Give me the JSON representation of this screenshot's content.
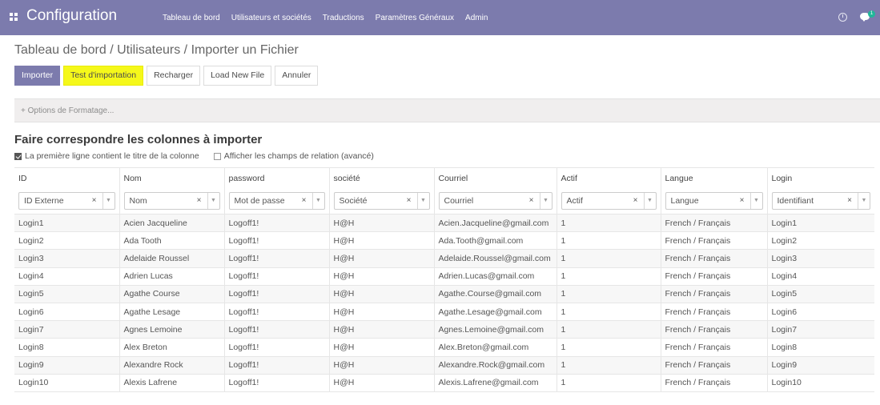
{
  "topbar": {
    "app_title": "Configuration",
    "menu": [
      "Tableau de bord",
      "Utilisateurs et sociétés",
      "Traductions",
      "Paramètres Généraux",
      "Admin"
    ],
    "chat_badge": "1",
    "bar_color": "#7c7bad"
  },
  "breadcrumb": "Tableau de bord / Utilisateurs / Importer un Fichier",
  "buttons": {
    "import": "Importer",
    "test_import": "Test d'importation",
    "reload": "Recharger",
    "load_new_file": "Load New File",
    "cancel": "Annuler"
  },
  "options_label": "+ Options de Formatage...",
  "section_title": "Faire correspondre les colonnes à importer",
  "checkboxes": {
    "first_line_header": {
      "label": "La première ligne contient le titre de la colonne",
      "checked": true
    },
    "show_relation_fields": {
      "label": "Afficher les champs de relation (avancé)",
      "checked": false
    }
  },
  "table": {
    "headers": [
      "ID",
      "Nom",
      "password",
      "société",
      "Courriel",
      "Actif",
      "Langue",
      "Login"
    ],
    "mappings": [
      "ID Externe",
      "Nom",
      "Mot de passe",
      "Société",
      "Courriel",
      "Actif",
      "Langue",
      "Identifiant"
    ],
    "rows": [
      [
        "Login1",
        "Acien Jacqueline",
        "Logoff1!",
        "H@H",
        "Acien.Jacqueline@gmail.com",
        "1",
        "French / Français",
        "Login1"
      ],
      [
        "Login2",
        "Ada Tooth",
        "Logoff1!",
        "H@H",
        "Ada.Tooth@gmail.com",
        "1",
        "French / Français",
        "Login2"
      ],
      [
        "Login3",
        "Adelaide Roussel",
        "Logoff1!",
        "H@H",
        "Adelaide.Roussel@gmail.com",
        "1",
        "French / Français",
        "Login3"
      ],
      [
        "Login4",
        "Adrien Lucas",
        "Logoff1!",
        "H@H",
        "Adrien.Lucas@gmail.com",
        "1",
        "French / Français",
        "Login4"
      ],
      [
        "Login5",
        "Agathe Course",
        "Logoff1!",
        "H@H",
        "Agathe.Course@gmail.com",
        "1",
        "French / Français",
        "Login5"
      ],
      [
        "Login6",
        "Agathe Lesage",
        "Logoff1!",
        "H@H",
        "Agathe.Lesage@gmail.com",
        "1",
        "French / Français",
        "Login6"
      ],
      [
        "Login7",
        "Agnes Lemoine",
        "Logoff1!",
        "H@H",
        "Agnes.Lemoine@gmail.com",
        "1",
        "French / Français",
        "Login7"
      ],
      [
        "Login8",
        "Alex Breton",
        "Logoff1!",
        "H@H",
        "Alex.Breton@gmail.com",
        "1",
        "French / Français",
        "Login8"
      ],
      [
        "Login9",
        "Alexandre Rock",
        "Logoff1!",
        "H@H",
        "Alexandre.Rock@gmail.com",
        "1",
        "French / Français",
        "Login9"
      ],
      [
        "Login10",
        "Alexis Lafrene",
        "Logoff1!",
        "H@H",
        "Alexis.Lafrene@gmail.com",
        "1",
        "French / Français",
        "Login10"
      ]
    ]
  }
}
